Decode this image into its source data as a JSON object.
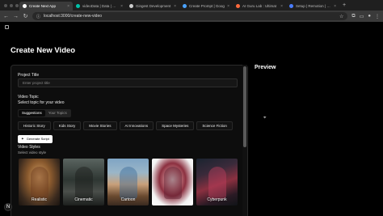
{
  "browser": {
    "tabs": [
      {
        "title": "Create Next App",
        "color": "#ffffff",
        "active": true
      },
      {
        "title": "videoData | Data | Dev",
        "color": "#00c2a8",
        "active": false
      },
      {
        "title": "Gingest Development",
        "color": "#cccccc",
        "active": false
      },
      {
        "title": "Create Prompt | Goog",
        "color": "#4aa3ff",
        "active": false
      },
      {
        "title": "AI Guru Lab : Ultimat",
        "color": "#ff6a3d",
        "active": false
      },
      {
        "title": "Setup | Remotion | Mak",
        "color": "#4a7dff",
        "active": false
      }
    ],
    "url": "localhost:3000/create-new-video"
  },
  "page": {
    "title": "Create New Video",
    "preview_title": "Preview"
  },
  "form": {
    "project_title_label": "Project Title",
    "project_title_placeholder": "Enter project title",
    "video_topic_label": "Video Topic",
    "video_topic_sublabel": "Select topic for your video",
    "topic_tabs": [
      "Suggestions",
      "Your Topics"
    ],
    "topic_chips": [
      "Historic Story",
      "Kids Story",
      "Movie Stories",
      "AI Innovations",
      "Space Mysteries",
      "Science Fiction"
    ],
    "generate_button": "Generate Script",
    "video_styles_label": "Video Styles",
    "video_styles_sublabel": "Select video style",
    "styles": [
      "Realistic",
      "Cinematic",
      "Cartoon",
      "",
      "Cyberpunk"
    ]
  },
  "fab_label": "N"
}
